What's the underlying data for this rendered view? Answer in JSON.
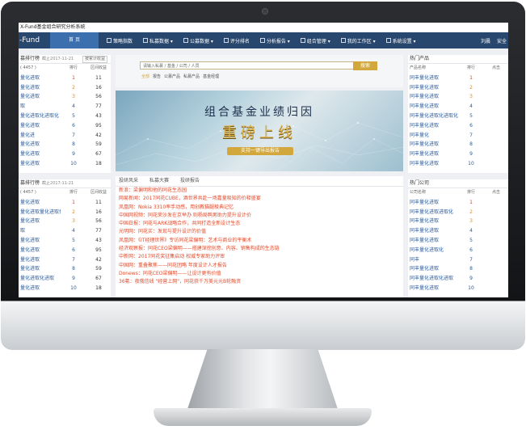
{
  "app": {
    "title": "X-Fund基金组合研究分析系统",
    "logo": "-Fund"
  },
  "nav": {
    "home": "首 页",
    "items": [
      "策略指数",
      "私募数据 ▾",
      "公募数据 ▾",
      "评分排名",
      "分析报告 ▾",
      "组合管理 ▾",
      "我的工作区 ▾",
      "系统设置 ▾"
    ],
    "right": [
      "刘晨",
      "安全"
    ]
  },
  "left_top": {
    "title": "募排行榜",
    "sub": "截止2017-11-21",
    "select": "按累计收益",
    "count_label": "( 4457 )",
    "headers": [
      "",
      "排行",
      "区间收益"
    ],
    "rows": [
      {
        "name": "量化进取",
        "rank": "1",
        "value": "11"
      },
      {
        "name": "量化进取",
        "rank": "2",
        "value": "16"
      },
      {
        "name": "量化进取",
        "rank": "3",
        "value": "56"
      },
      {
        "name": "取",
        "rank": "4",
        "value": "77"
      },
      {
        "name": "量化进取化进取化",
        "rank": "5",
        "value": "43"
      },
      {
        "name": "量化进取",
        "rank": "6",
        "value": "95"
      },
      {
        "name": "量化进",
        "rank": "7",
        "value": "42"
      },
      {
        "name": "量化进取",
        "rank": "8",
        "value": "59"
      },
      {
        "name": "量化进取",
        "rank": "9",
        "value": "67"
      },
      {
        "name": "量化进取",
        "rank": "10",
        "value": "18"
      }
    ]
  },
  "left_bottom": {
    "title": "募排行榜",
    "sub": "截止2017-11-21",
    "count_label": "( 4457 )",
    "headers": [
      "",
      "排行",
      "区间收益"
    ],
    "rows": [
      {
        "name": "量化进取",
        "rank": "1",
        "value": "11"
      },
      {
        "name": "量化进取量化进取化",
        "rank": "2",
        "value": "16"
      },
      {
        "name": "量化进取",
        "rank": "3",
        "value": "56"
      },
      {
        "name": "取",
        "rank": "4",
        "value": "77"
      },
      {
        "name": "量化进取",
        "rank": "5",
        "value": "43"
      },
      {
        "name": "量化进取",
        "rank": "6",
        "value": "95"
      },
      {
        "name": "量化进取",
        "rank": "7",
        "value": "42"
      },
      {
        "name": "量化进取",
        "rank": "8",
        "value": "59"
      },
      {
        "name": "量化进取化进取",
        "rank": "9",
        "value": "67"
      },
      {
        "name": "量化进取",
        "rank": "10",
        "value": "18"
      }
    ]
  },
  "search": {
    "placeholder": "请输入私募 / 基金 / 公司 / 人员",
    "button": "搜索",
    "categories": [
      "全部",
      "报告",
      "公募产品",
      "私募产品",
      "基金经理"
    ]
  },
  "banner": {
    "title": "组合基金业绩归因",
    "subtitle": "重磅上线",
    "button": "支持一键导出报告"
  },
  "news": {
    "tabs": [
      "投研风采",
      "私募大赛",
      "投研报告"
    ],
    "items": [
      "新浪：梁偏明和他的同花生态园",
      "网易新闻：2017同花CUBE，酒世界共赴一场嘉量吸知的价释盛宴",
      "凤凰网：Nokia 3310率手动感，用创教猫腿棱典记忆",
      "中国网视频：同花荣沙发在京举办 则杨局鸭男助力提升设计价",
      "中国日报：同花与ARK战略合作，共同打造全新设计生态",
      "光明网：同花买：发现与提升设计的价值",
      "凤凰网：《IT经理世界》专访同花梁偏明：艺术与商业的平衡术",
      "经济观察报：同花CEO梁偏明——搭建深挖创意、内容、销售构成的生态链",
      "中新网：2017同花奖征集启动 权威专家助力评审",
      "中国网：重叠聚焦——同花团略 年度设计人才报告",
      "Donews：同花CEO梁偏明——让设计更有价值",
      "36氪：夜俄信线 \"经营上网\"，同花获千万美元元B轮融资"
    ]
  },
  "right_top": {
    "title": "热门产品",
    "headers": [
      "产品名称",
      "排行",
      "点击"
    ],
    "rows": [
      {
        "name": "同丰量化进取",
        "rank": "1"
      },
      {
        "name": "同丰量化进取",
        "rank": "2"
      },
      {
        "name": "同丰量化进取",
        "rank": "3"
      },
      {
        "name": "同丰量化进取",
        "rank": "4"
      },
      {
        "name": "同丰量化进取化进取化",
        "rank": "5"
      },
      {
        "name": "同丰量化进取",
        "rank": "6"
      },
      {
        "name": "同丰量化",
        "rank": "7"
      },
      {
        "name": "同丰量化进取",
        "rank": "8"
      },
      {
        "name": "同丰量化进取",
        "rank": "9"
      },
      {
        "name": "同丰量化进取",
        "rank": "10"
      }
    ]
  },
  "right_bottom": {
    "title": "热门公司",
    "headers": [
      "公司名称",
      "排行",
      "点击"
    ],
    "rows": [
      {
        "name": "同丰量化进取",
        "rank": "1"
      },
      {
        "name": "同丰量化进取进取化",
        "rank": "2"
      },
      {
        "name": "同丰量化进取",
        "rank": "3"
      },
      {
        "name": "同丰量化进取",
        "rank": "4"
      },
      {
        "name": "同丰量化进取",
        "rank": "5"
      },
      {
        "name": "同丰量化进取化",
        "rank": "6"
      },
      {
        "name": "同丰",
        "rank": "7"
      },
      {
        "name": "同丰量化进取",
        "rank": "8"
      },
      {
        "name": "同丰量化进取化进取",
        "rank": "9"
      },
      {
        "name": "同丰量化进取",
        "rank": "10"
      }
    ]
  },
  "colors": {
    "nav_bg": "#28476e",
    "accent_gold": "#d2a73c",
    "link_blue": "#2b5c9e",
    "news_red": "#e24a2a"
  }
}
